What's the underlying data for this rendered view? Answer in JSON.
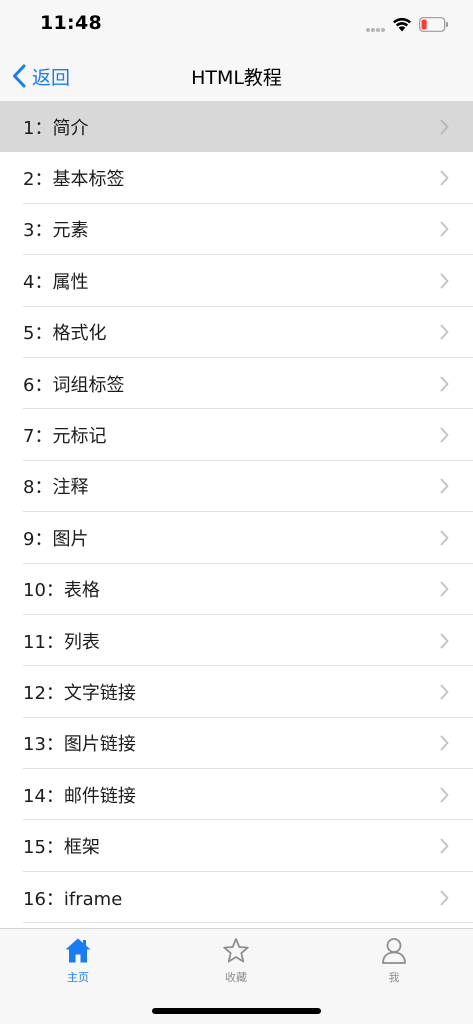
{
  "status_bar": {
    "time": "11:48"
  },
  "nav": {
    "back_label": "返回",
    "title": "HTML教程"
  },
  "list": {
    "items": [
      {
        "label": "1：简介",
        "selected": true
      },
      {
        "label": "2：基本标签"
      },
      {
        "label": "3：元素"
      },
      {
        "label": "4：属性"
      },
      {
        "label": "5：格式化"
      },
      {
        "label": "6：词组标签"
      },
      {
        "label": "7：元标记"
      },
      {
        "label": "8：注释"
      },
      {
        "label": "9：图片"
      },
      {
        "label": "10：表格"
      },
      {
        "label": "11：列表"
      },
      {
        "label": "12：文字链接"
      },
      {
        "label": "13：图片链接"
      },
      {
        "label": "14：邮件链接"
      },
      {
        "label": "15：框架"
      },
      {
        "label": "16：iframe"
      }
    ]
  },
  "tab_bar": {
    "tabs": [
      {
        "label": "主页",
        "icon": "home-icon",
        "active": true
      },
      {
        "label": "收藏",
        "icon": "star-icon"
      },
      {
        "label": "我",
        "icon": "person-icon"
      }
    ]
  },
  "colors": {
    "accent": "#1a7cf2",
    "selected_row": "#d8d8d8",
    "inactive_tab": "#8e8e93",
    "battery_low": "#ff3b30"
  }
}
